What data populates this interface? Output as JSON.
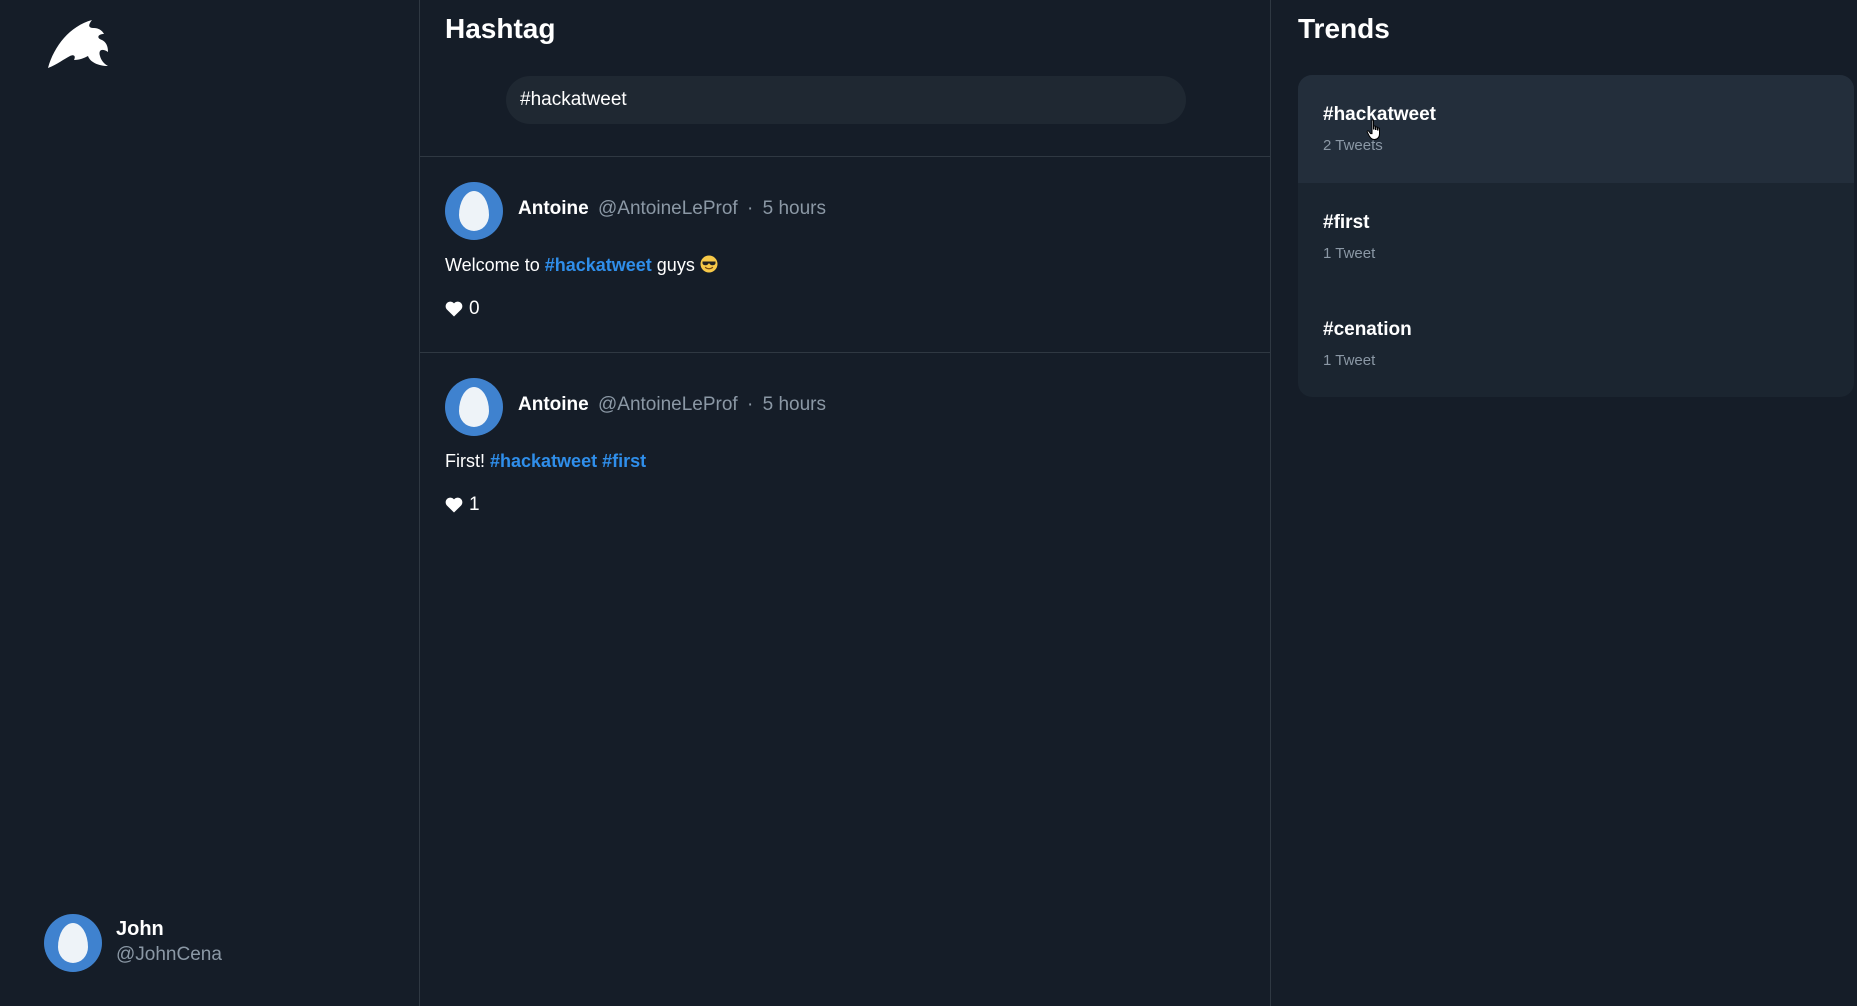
{
  "sidebar": {
    "logo_icon": "bird-wing-icon",
    "current_user": {
      "display_name": "John",
      "handle": "@JohnCena",
      "avatar_icon": "egg-avatar-icon"
    }
  },
  "main": {
    "title": "Hashtag",
    "search": {
      "value": "#hackatweet",
      "placeholder": ""
    },
    "tweets": [
      {
        "author": "Antoine",
        "handle": "@AntoineLeProf",
        "separator": "·",
        "time": "5 hours",
        "text_before": "Welcome to",
        "hashtags": [
          "#hackatweet"
        ],
        "text_after": "guys",
        "emoji": "smiling-face-with-sunglasses",
        "likes": "0",
        "like_icon": "heart-icon"
      },
      {
        "author": "Antoine",
        "handle": "@AntoineLeProf",
        "separator": "·",
        "time": "5 hours",
        "text_before": "First!",
        "hashtags": [
          "#hackatweet",
          "#first"
        ],
        "likes": "1",
        "like_icon": "heart-icon"
      }
    ]
  },
  "trends": {
    "title": "Trends",
    "items": [
      {
        "tag": "#hackatweet",
        "count": "2 Tweets"
      },
      {
        "tag": "#first",
        "count": "1 Tweet"
      },
      {
        "tag": "#cenation",
        "count": "1 Tweet"
      }
    ]
  },
  "colors": {
    "background": "#151d28",
    "accent": "#2f8eea",
    "avatar": "#3f82cf",
    "muted_text": "#8b98a5"
  }
}
